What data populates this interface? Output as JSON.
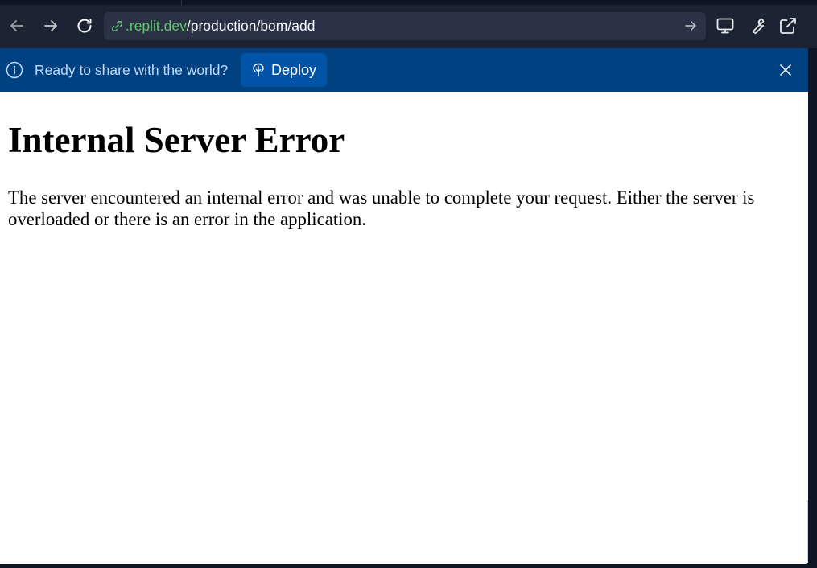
{
  "toolbar": {
    "url_domain": ".replit.dev",
    "url_path": "/production/bom/add",
    "icons": [
      "back-arrow-icon",
      "forward-arrow-icon",
      "reload-icon",
      "link-icon",
      "go-arrow-icon",
      "monitor-icon",
      "wrench-icon",
      "external-link-icon"
    ]
  },
  "banner": {
    "message": "Ready to share with the world?",
    "deploy_label": "Deploy",
    "icons": [
      "info-icon",
      "deploy-icon",
      "close-icon"
    ]
  },
  "page": {
    "title": "Internal Server Error",
    "message": "The server encountered an internal error and was unable to complete your request. Either the server is overloaded or there is an error in the application."
  },
  "colors": {
    "toolbar_bg": "#1c2333",
    "url_domain": "#5fc86e",
    "banner_bg": "#004182",
    "deploy_bg": "#0053a6",
    "page_bg": "#ffffff"
  }
}
